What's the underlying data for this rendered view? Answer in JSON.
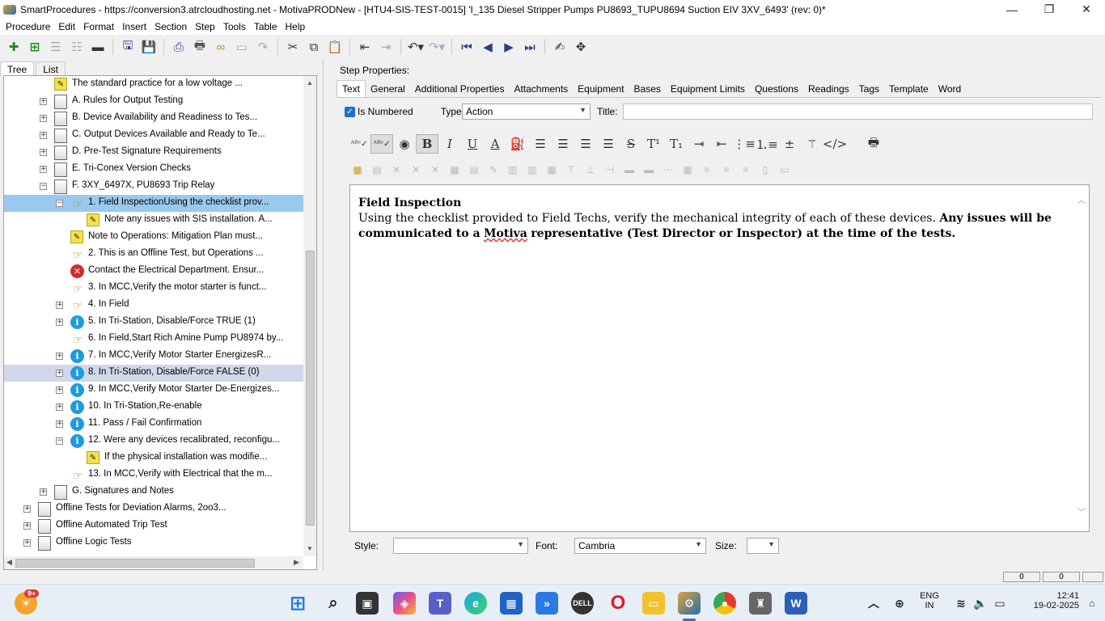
{
  "window": {
    "title": "SmartProcedures - https://conversion3.atrcloudhosting.net - MotivaPRODNew - [HTU4-SIS-TEST-0015] 'I_135 Diesel Stripper Pumps PU8693_TUPU8694 Suction EIV 3XV_6493' (rev: 0)*",
    "minimize": "—",
    "restore": "❐",
    "close": "✕"
  },
  "menu": [
    "Procedure",
    "Edit",
    "Format",
    "Insert",
    "Section",
    "Step",
    "Tools",
    "Table",
    "Help"
  ],
  "left_tabs": [
    "Tree",
    "List"
  ],
  "tree": [
    {
      "label": "The standard practice for a low voltage ...",
      "icon": "note-icon",
      "level": 1,
      "expander": ""
    },
    {
      "label": "A. Rules for Output Testing",
      "icon": "section-icon",
      "level": 1,
      "expander": "+"
    },
    {
      "label": "B. Device Availability and Readiness to Tes...",
      "icon": "section-icon",
      "level": 1,
      "expander": "+"
    },
    {
      "label": "C. Output Devices Available and Ready to Te...",
      "icon": "section-icon",
      "level": 1,
      "expander": "+"
    },
    {
      "label": "D. Pre-Test Signature Requirements",
      "icon": "section-icon",
      "level": 1,
      "expander": "+"
    },
    {
      "label": "E. Tri-Conex Version Checks",
      "icon": "section-icon",
      "level": 1,
      "expander": "+"
    },
    {
      "label": "F. 3XY_6497X, PU8693 Trip Relay",
      "icon": "section-icon",
      "level": 1,
      "expander": "−"
    },
    {
      "label": "1. Field InspectionUsing the checklist prov...",
      "icon": "hand-icon",
      "level": 2,
      "expander": "−",
      "selected": "active"
    },
    {
      "label": "Note any issues with SIS installation. A...",
      "icon": "note-icon",
      "level": 3,
      "expander": ""
    },
    {
      "label": "Note to Operations: Mitigation Plan must...",
      "icon": "note-icon",
      "level": 2,
      "expander": ""
    },
    {
      "label": "2. This is an Offline Test, but Operations ...",
      "icon": "hand-icon",
      "level": 2,
      "expander": ""
    },
    {
      "label": "Contact the Electrical Department. Ensur...",
      "icon": "warning-icon",
      "level": 2,
      "expander": ""
    },
    {
      "label": "3. In MCC,Verify the motor starter is funct...",
      "icon": "hand-icon",
      "level": 2,
      "expander": ""
    },
    {
      "label": "4. In Field",
      "icon": "hand-icon",
      "level": 2,
      "expander": "+"
    },
    {
      "label": "5. In Tri-Station, Disable/Force TRUE (1)",
      "icon": "info-icon",
      "level": 2,
      "expander": "+"
    },
    {
      "label": "6. In Field,Start Rich Amine Pump PU8974 by...",
      "icon": "hand-icon",
      "level": 2,
      "expander": ""
    },
    {
      "label": "7. In MCC,Verify Motor Starter EnergizesR...",
      "icon": "info-icon",
      "level": 2,
      "expander": "+"
    },
    {
      "label": "8. In Tri-Station, Disable/Force FALSE (0)",
      "icon": "info-icon",
      "level": 2,
      "expander": "+",
      "selected": "inactive"
    },
    {
      "label": "9. In MCC,Verify Motor Starter De-Energizes...",
      "icon": "info-icon",
      "level": 2,
      "expander": "+"
    },
    {
      "label": "10. In Tri-Station,Re-enable",
      "icon": "info-icon",
      "level": 2,
      "expander": "+"
    },
    {
      "label": "11. Pass / Fail Confirmation",
      "icon": "info-icon",
      "level": 2,
      "expander": "+"
    },
    {
      "label": "12. Were any devices recalibrated, reconfigu...",
      "icon": "info-icon",
      "level": 2,
      "expander": "−"
    },
    {
      "label": "If the physical installation was modifie...",
      "icon": "note-icon",
      "level": 3,
      "expander": ""
    },
    {
      "label": "13. In MCC,Verify with Electrical that the m...",
      "icon": "hand-icon",
      "level": 2,
      "expander": ""
    },
    {
      "label": "G. Signatures and Notes",
      "icon": "section-icon",
      "level": 1,
      "expander": "+"
    },
    {
      "label": "Offline Tests for Deviation Alarms, 2oo3...",
      "icon": "section-icon",
      "level": 0,
      "expander": "+"
    },
    {
      "label": "Offline Automated Trip Test",
      "icon": "section-icon",
      "level": 0,
      "expander": "+"
    },
    {
      "label": "Offline Logic Tests",
      "icon": "section-icon",
      "level": 0,
      "expander": "+"
    }
  ],
  "step_properties": {
    "label": "Step Properties:",
    "tabs": [
      "Text",
      "General",
      "Additional Properties",
      "Attachments",
      "Equipment",
      "Bases",
      "Equipment Limits",
      "Questions",
      "Readings",
      "Tags",
      "Template",
      "Word"
    ],
    "is_numbered_label": "Is Numbered",
    "type_label": "Type:",
    "type_value": "Action",
    "title_label": "Title:",
    "title_value": "",
    "style_label": "Style:",
    "style_value": "",
    "font_label": "Font:",
    "font_value": "Cambria",
    "size_label": "Size:",
    "size_value": ""
  },
  "editor": {
    "heading": "Field Inspection",
    "text_plain": "Using the checklist provided to Field Techs, verify the mechanical integrity of each of these devices.",
    "text_bold_1": "Any issues will be communicated to a",
    "text_bold_misspelled": "Motiva",
    "text_bold_2": "representative (Test Director or Inspector) at the time of the tests."
  },
  "status": {
    "box1": "0",
    "box2": "0"
  },
  "taskbar": {
    "badge": "9+",
    "lang_line1": "ENG",
    "lang_line2": "IN",
    "time": "12:41",
    "date": "19-02-2025"
  },
  "colors": {
    "selection_active": "#99c9ef",
    "selection_inactive": "#cfd9ea",
    "accent": "#1f6fd0"
  }
}
